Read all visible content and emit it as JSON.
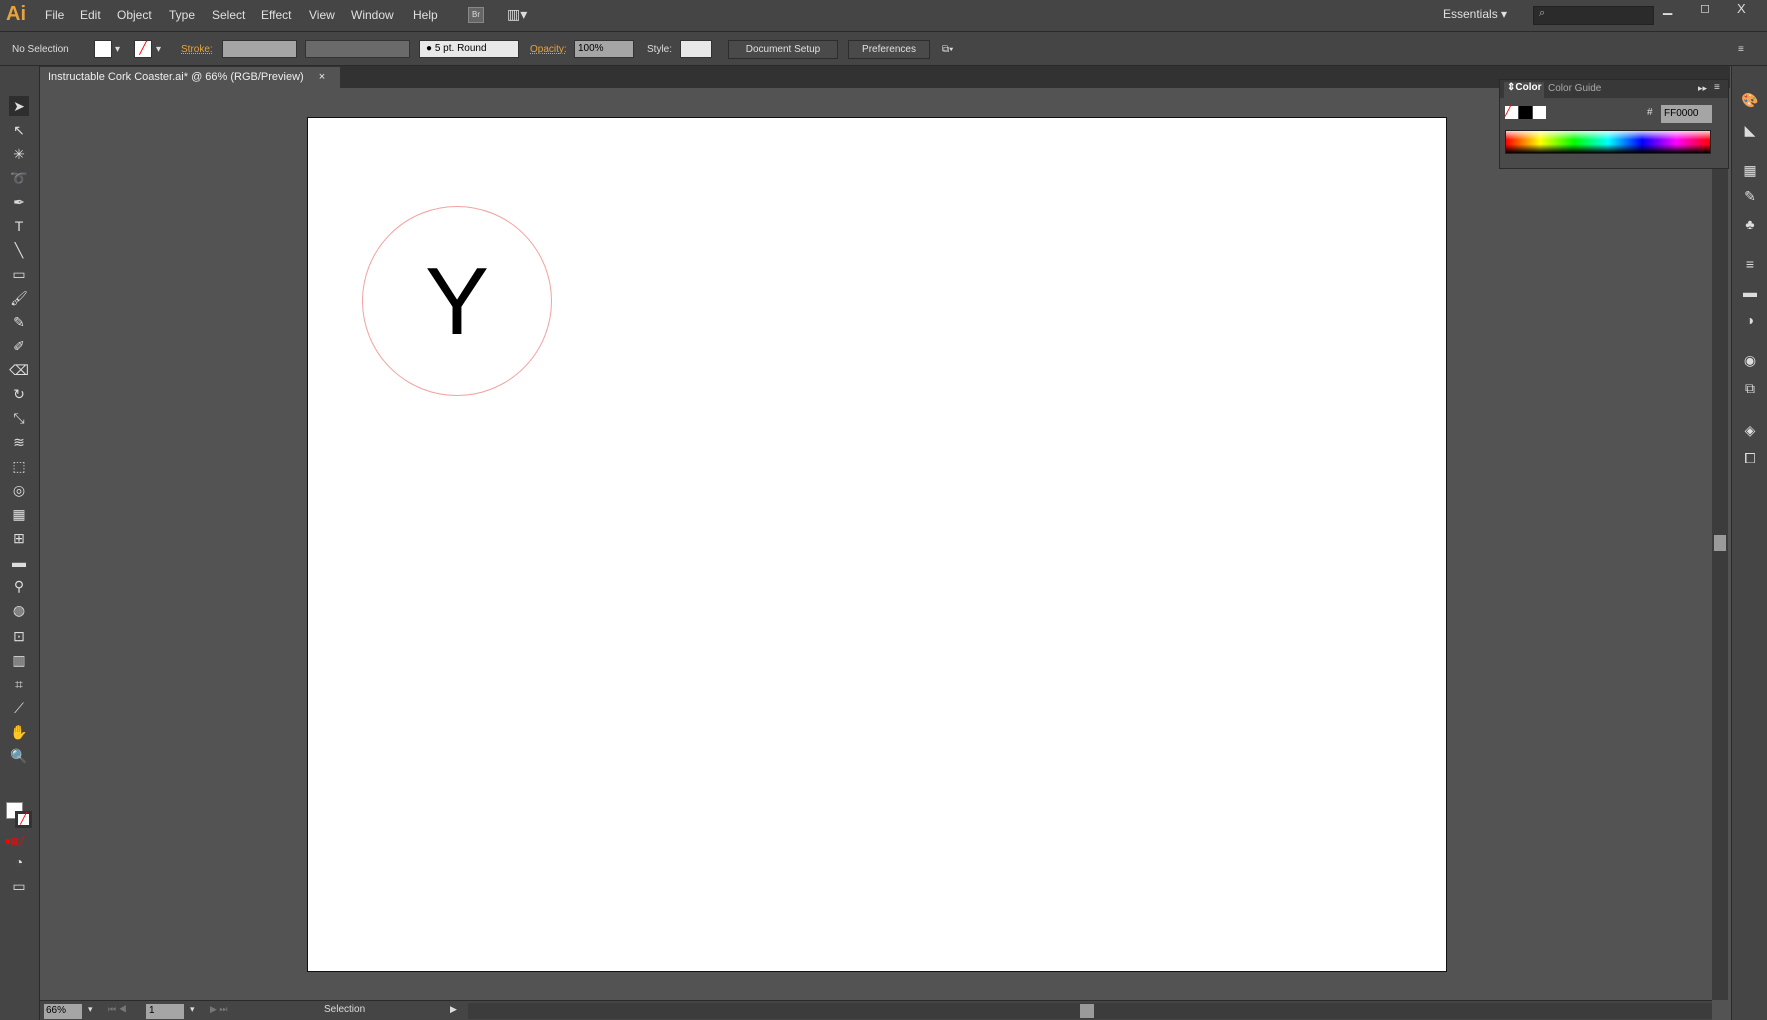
{
  "app": {
    "logo": "Ai",
    "menus": [
      "File",
      "Edit",
      "Object",
      "Type",
      "Select",
      "Effect",
      "View",
      "Window",
      "Help"
    ],
    "bridge": "Br",
    "workspace": "Essentials",
    "search_placeholder": ""
  },
  "control": {
    "selection": "No Selection",
    "stroke_label": "Stroke:",
    "brush": "5 pt. Round",
    "opacity_label": "Opacity:",
    "opacity": "100%",
    "style_label": "Style:",
    "document_setup": "Document Setup",
    "preferences": "Preferences"
  },
  "document": {
    "tab": "Instructable Cork Coaster.ai* @ 66% (RGB/Preview)",
    "close": "×",
    "letter": "Y",
    "circle_stroke": "#f4a0a0"
  },
  "color_panel": {
    "tabs": [
      "Color",
      "Color Guide"
    ],
    "hash": "#",
    "hex": "FF0000"
  },
  "status": {
    "zoom": "66%",
    "artboard": "1",
    "tool": "Selection"
  },
  "colors": {
    "chrome": "#454545",
    "canvas": "#535353",
    "accent": "#e8a33c"
  }
}
